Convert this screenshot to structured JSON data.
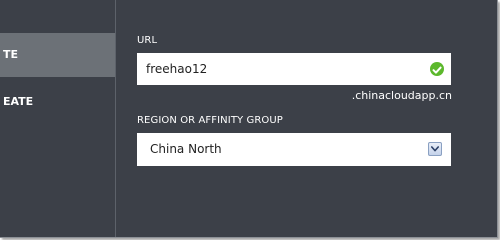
{
  "sidebar": {
    "items": [
      {
        "label": "TE",
        "selected": true
      },
      {
        "label": "EATE",
        "selected": false
      }
    ]
  },
  "form": {
    "url_label": "URL",
    "url_value": "freehao12",
    "url_suffix": ".chinacloudapp.cn",
    "url_valid_icon": "check-circle-icon",
    "region_label": "REGION OR AFFINITY GROUP",
    "region_value": "China North",
    "region_dropdown_icon": "chevron-down-icon"
  },
  "colors": {
    "background": "#3c4048",
    "selected_item": "#6c7177",
    "valid": "#5cb82c"
  }
}
